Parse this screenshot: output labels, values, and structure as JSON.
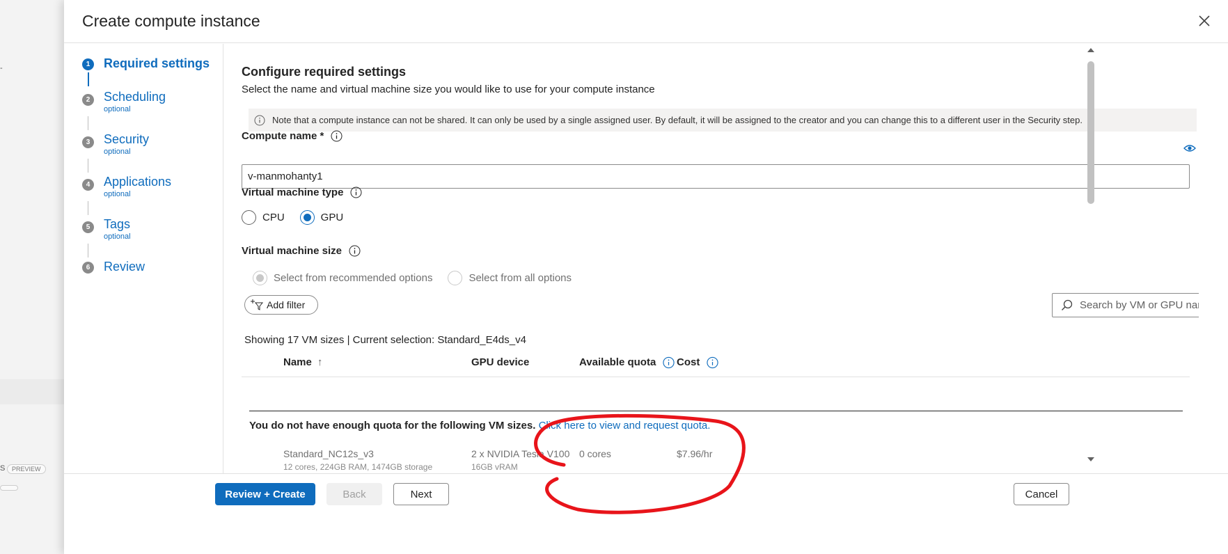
{
  "background": {
    "fragment1": "-",
    "fragment2": "S",
    "badge": "PREVIEW"
  },
  "panel": {
    "title": "Create compute instance"
  },
  "wizard": {
    "steps": [
      {
        "num": "1",
        "label": "Required settings",
        "sub": ""
      },
      {
        "num": "2",
        "label": "Scheduling",
        "sub": "optional"
      },
      {
        "num": "3",
        "label": "Security",
        "sub": "optional"
      },
      {
        "num": "4",
        "label": "Applications",
        "sub": "optional"
      },
      {
        "num": "5",
        "label": "Tags",
        "sub": "optional"
      },
      {
        "num": "6",
        "label": "Review",
        "sub": ""
      }
    ]
  },
  "content": {
    "heading": "Configure required settings",
    "description": "Select the name and virtual machine size you would like to use for your compute instance",
    "note": "Note that a compute instance can not be shared. It can only be used by a single assigned user. By default, it will be assigned to the creator and you can change this to a different user in the Security step.",
    "compute_name_label": "Compute name *",
    "compute_name_value": "v-manmohanty1",
    "vm_type_label": "Virtual machine type",
    "vm_type_options": [
      "CPU",
      "GPU"
    ],
    "vm_type_selected": "GPU",
    "vm_size_label": "Virtual machine size",
    "vm_size_options": [
      "Select from recommended options",
      "Select from all options"
    ],
    "add_filter": "Add filter",
    "search_placeholder": "Search by VM or GPU name...",
    "showing": "Showing 17 VM sizes | Current selection: Standard_E4ds_v4",
    "columns": {
      "name": "Name",
      "sort": "↑",
      "gpu": "GPU device",
      "quota": "Available quota",
      "cost": "Cost"
    },
    "quota_message": "You do not have enough quota for the following VM sizes.",
    "quota_link": "Click here to view and request quota.",
    "row": {
      "name": "Standard_NC12s_v3",
      "specs": "12 cores, 224GB RAM, 1474GB storage",
      "gpu": "2 x NVIDIA Tesla V100",
      "gpu_mem": "16GB vRAM",
      "quota": "0 cores",
      "cost": "$7.96/hr"
    }
  },
  "footer": {
    "review_create": "Review + Create",
    "back": "Back",
    "next": "Next",
    "cancel": "Cancel"
  },
  "colors": {
    "accent": "#0f6cbd",
    "annotation": "#e8141a"
  },
  "icons": [
    "close-icon",
    "info-icon",
    "eye-icon",
    "search-icon",
    "filter-icon"
  ]
}
